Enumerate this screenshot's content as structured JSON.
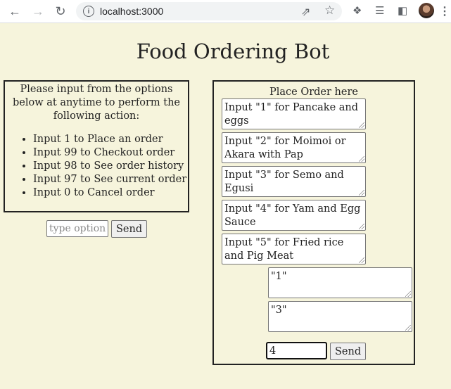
{
  "browser": {
    "url": "localhost:3000"
  },
  "page": {
    "title": "Food Ordering Bot"
  },
  "options_panel": {
    "intro": "Please input from the options below at anytime to perform the following action:",
    "items": [
      "Input 1 to Place an order",
      "Input 99 to Checkout order",
      "Input 98 to See order history",
      "Input 97 to See current order",
      "Input 0 to Cancel order"
    ],
    "input_placeholder": "type option",
    "send_label": "Send"
  },
  "chat": {
    "title": "Place Order here",
    "bot_messages": [
      "Input \"1\" for Pancake and eggs",
      "Input \"2\" for Moimoi or Akara with Pap",
      "Input \"3\" for Semo and Egusi",
      "Input \"4\" for Yam and Egg Sauce",
      "Input \"5\" for Fried rice and Pig Meat"
    ],
    "user_messages": [
      "\"1\"",
      "\"3\""
    ],
    "input_value": "4",
    "send_label": "Send"
  }
}
